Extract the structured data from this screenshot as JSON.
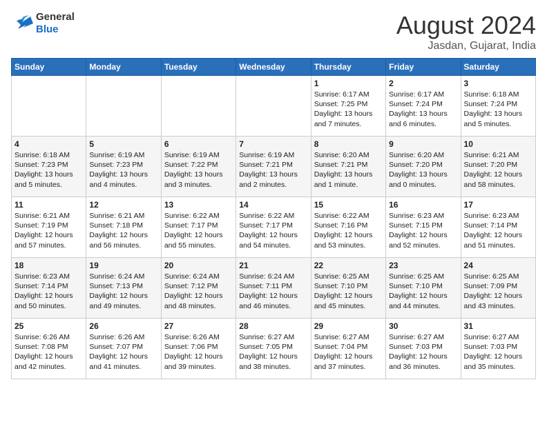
{
  "logo": {
    "text1": "General",
    "text2": "Blue"
  },
  "title": {
    "month_year": "August 2024",
    "location": "Jasdan, Gujarat, India"
  },
  "days_of_week": [
    "Sunday",
    "Monday",
    "Tuesday",
    "Wednesday",
    "Thursday",
    "Friday",
    "Saturday"
  ],
  "weeks": [
    [
      {
        "day": "",
        "info": ""
      },
      {
        "day": "",
        "info": ""
      },
      {
        "day": "",
        "info": ""
      },
      {
        "day": "",
        "info": ""
      },
      {
        "day": "1",
        "info": "Sunrise: 6:17 AM\nSunset: 7:25 PM\nDaylight: 13 hours\nand 7 minutes."
      },
      {
        "day": "2",
        "info": "Sunrise: 6:17 AM\nSunset: 7:24 PM\nDaylight: 13 hours\nand 6 minutes."
      },
      {
        "day": "3",
        "info": "Sunrise: 6:18 AM\nSunset: 7:24 PM\nDaylight: 13 hours\nand 5 minutes."
      }
    ],
    [
      {
        "day": "4",
        "info": "Sunrise: 6:18 AM\nSunset: 7:23 PM\nDaylight: 13 hours\nand 5 minutes."
      },
      {
        "day": "5",
        "info": "Sunrise: 6:19 AM\nSunset: 7:23 PM\nDaylight: 13 hours\nand 4 minutes."
      },
      {
        "day": "6",
        "info": "Sunrise: 6:19 AM\nSunset: 7:22 PM\nDaylight: 13 hours\nand 3 minutes."
      },
      {
        "day": "7",
        "info": "Sunrise: 6:19 AM\nSunset: 7:21 PM\nDaylight: 13 hours\nand 2 minutes."
      },
      {
        "day": "8",
        "info": "Sunrise: 6:20 AM\nSunset: 7:21 PM\nDaylight: 13 hours\nand 1 minute."
      },
      {
        "day": "9",
        "info": "Sunrise: 6:20 AM\nSunset: 7:20 PM\nDaylight: 13 hours\nand 0 minutes."
      },
      {
        "day": "10",
        "info": "Sunrise: 6:21 AM\nSunset: 7:20 PM\nDaylight: 12 hours\nand 58 minutes."
      }
    ],
    [
      {
        "day": "11",
        "info": "Sunrise: 6:21 AM\nSunset: 7:19 PM\nDaylight: 12 hours\nand 57 minutes."
      },
      {
        "day": "12",
        "info": "Sunrise: 6:21 AM\nSunset: 7:18 PM\nDaylight: 12 hours\nand 56 minutes."
      },
      {
        "day": "13",
        "info": "Sunrise: 6:22 AM\nSunset: 7:17 PM\nDaylight: 12 hours\nand 55 minutes."
      },
      {
        "day": "14",
        "info": "Sunrise: 6:22 AM\nSunset: 7:17 PM\nDaylight: 12 hours\nand 54 minutes."
      },
      {
        "day": "15",
        "info": "Sunrise: 6:22 AM\nSunset: 7:16 PM\nDaylight: 12 hours\nand 53 minutes."
      },
      {
        "day": "16",
        "info": "Sunrise: 6:23 AM\nSunset: 7:15 PM\nDaylight: 12 hours\nand 52 minutes."
      },
      {
        "day": "17",
        "info": "Sunrise: 6:23 AM\nSunset: 7:14 PM\nDaylight: 12 hours\nand 51 minutes."
      }
    ],
    [
      {
        "day": "18",
        "info": "Sunrise: 6:23 AM\nSunset: 7:14 PM\nDaylight: 12 hours\nand 50 minutes."
      },
      {
        "day": "19",
        "info": "Sunrise: 6:24 AM\nSunset: 7:13 PM\nDaylight: 12 hours\nand 49 minutes."
      },
      {
        "day": "20",
        "info": "Sunrise: 6:24 AM\nSunset: 7:12 PM\nDaylight: 12 hours\nand 48 minutes."
      },
      {
        "day": "21",
        "info": "Sunrise: 6:24 AM\nSunset: 7:11 PM\nDaylight: 12 hours\nand 46 minutes."
      },
      {
        "day": "22",
        "info": "Sunrise: 6:25 AM\nSunset: 7:10 PM\nDaylight: 12 hours\nand 45 minutes."
      },
      {
        "day": "23",
        "info": "Sunrise: 6:25 AM\nSunset: 7:10 PM\nDaylight: 12 hours\nand 44 minutes."
      },
      {
        "day": "24",
        "info": "Sunrise: 6:25 AM\nSunset: 7:09 PM\nDaylight: 12 hours\nand 43 minutes."
      }
    ],
    [
      {
        "day": "25",
        "info": "Sunrise: 6:26 AM\nSunset: 7:08 PM\nDaylight: 12 hours\nand 42 minutes."
      },
      {
        "day": "26",
        "info": "Sunrise: 6:26 AM\nSunset: 7:07 PM\nDaylight: 12 hours\nand 41 minutes."
      },
      {
        "day": "27",
        "info": "Sunrise: 6:26 AM\nSunset: 7:06 PM\nDaylight: 12 hours\nand 39 minutes."
      },
      {
        "day": "28",
        "info": "Sunrise: 6:27 AM\nSunset: 7:05 PM\nDaylight: 12 hours\nand 38 minutes."
      },
      {
        "day": "29",
        "info": "Sunrise: 6:27 AM\nSunset: 7:04 PM\nDaylight: 12 hours\nand 37 minutes."
      },
      {
        "day": "30",
        "info": "Sunrise: 6:27 AM\nSunset: 7:03 PM\nDaylight: 12 hours\nand 36 minutes."
      },
      {
        "day": "31",
        "info": "Sunrise: 6:27 AM\nSunset: 7:03 PM\nDaylight: 12 hours\nand 35 minutes."
      }
    ]
  ]
}
